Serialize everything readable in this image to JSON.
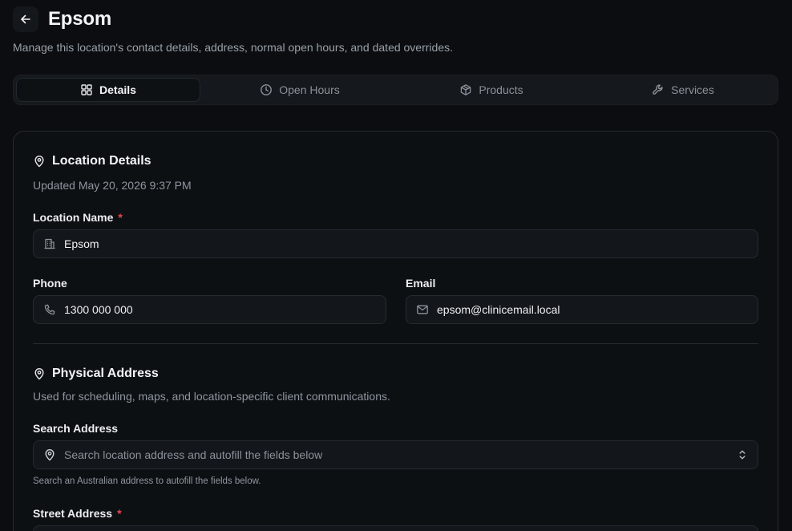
{
  "header": {
    "title": "Epsom",
    "subtitle": "Manage this location's contact details, address, normal open hours, and dated overrides."
  },
  "tabs": [
    {
      "label": "Details",
      "active": true,
      "icon": "grid-icon"
    },
    {
      "label": "Open Hours",
      "active": false,
      "icon": "clock-icon"
    },
    {
      "label": "Products",
      "active": false,
      "icon": "box-icon"
    },
    {
      "label": "Services",
      "active": false,
      "icon": "wrench-icon"
    }
  ],
  "location_details": {
    "title": "Location Details",
    "updated": "Updated May 20, 2026 9:37 PM",
    "name_label": "Location Name",
    "required_mark": "*",
    "name_value": "Epsom",
    "phone_label": "Phone",
    "phone_value": "1300 000 000",
    "email_label": "Email",
    "email_value": "epsom@clinicemail.local"
  },
  "physical_address": {
    "title": "Physical Address",
    "description": "Used for scheduling, maps, and location-specific client communications.",
    "search_label": "Search Address",
    "search_placeholder": "Search location address and autofill the fields below",
    "search_help": "Search an Australian address to autofill the fields below.",
    "street_label": "Street Address",
    "required_mark": "*"
  },
  "colors": {
    "background": "#0b0d10",
    "card": "#0d1013",
    "border": "#262b32",
    "required": "#e5484d"
  }
}
